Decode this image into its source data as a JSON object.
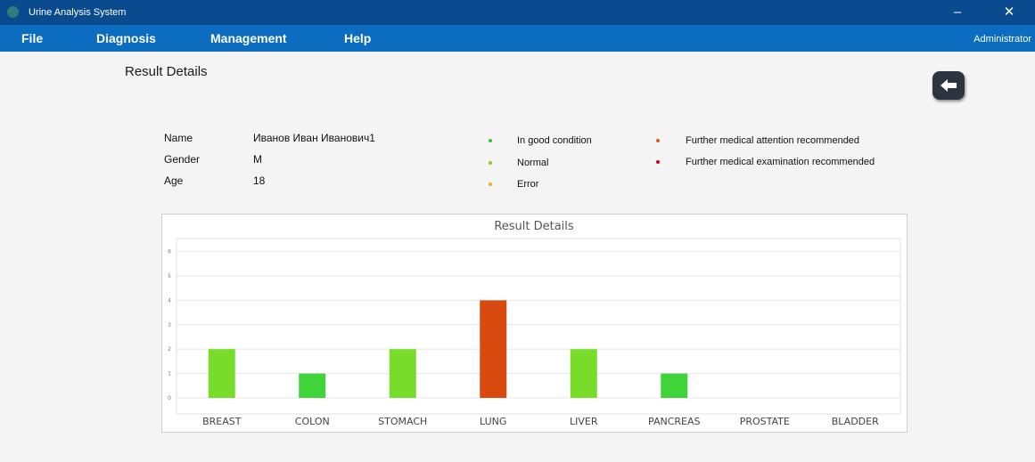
{
  "window": {
    "title": "Urine Analysis System",
    "minimize": "–",
    "close": "✕",
    "icon": "app-icon"
  },
  "menu": {
    "items": [
      "File",
      "Diagnosis",
      "Management",
      "Help"
    ],
    "user": "Administrator"
  },
  "page": {
    "heading": "Result Details",
    "back_icon": "arrow-left-icon"
  },
  "patient": {
    "name_label": "Name",
    "name": "Иванов Иван Иванович1",
    "gender_label": "Gender",
    "gender": "M",
    "age_label": "Age",
    "age": "18"
  },
  "legend": [
    {
      "text": "In good condition",
      "color": "#3ec43e"
    },
    {
      "text": "Normal",
      "color": "#7ed321"
    },
    {
      "text": "Error",
      "color": "#f5a623"
    },
    {
      "text": "Further medical attention recommended",
      "color": "#e05a1a"
    },
    {
      "text": "Further medical examination recommended",
      "color": "#d0021b"
    }
  ],
  "chart_data": {
    "type": "bar",
    "title": "Result Details",
    "categories": [
      "BREAST",
      "COLON",
      "STOMACH",
      "LUNG",
      "LIVER",
      "PANCREAS",
      "PROSTATE",
      "BLADDER"
    ],
    "values": [
      2,
      1,
      2,
      4,
      2,
      1,
      0,
      0
    ],
    "bar_colors": [
      "#77dd2a",
      "#3ed43a",
      "#77dd2a",
      "#d84a10",
      "#77dd2a",
      "#3ed43a",
      "#77dd2a",
      "#77dd2a"
    ],
    "yticks": [
      "0",
      "1",
      "2",
      "3",
      "4",
      "5",
      "6"
    ],
    "ylim": [
      0,
      6
    ],
    "grid": true
  }
}
